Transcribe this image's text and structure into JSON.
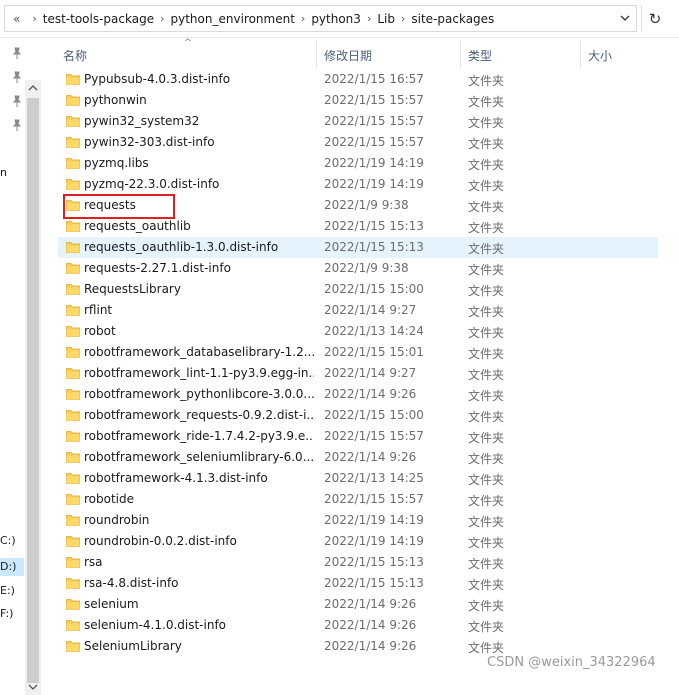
{
  "address": {
    "back_glyph": "«",
    "crumbs": [
      "test-tools-package",
      "python_environment",
      "python3",
      "Lib",
      "site-packages"
    ],
    "separator": "›",
    "refresh_glyph": "↻"
  },
  "columns": {
    "name": "名称",
    "date": "修改日期",
    "type": "类型",
    "size": "大小"
  },
  "nav": {
    "drives": [
      "n",
      "C:)",
      "D:)",
      "E:)",
      "F:)"
    ]
  },
  "files": [
    {
      "name": "Pypubsub-4.0.3.dist-info",
      "date": "2022/1/15 16:57",
      "type": "文件夹"
    },
    {
      "name": "pythonwin",
      "date": "2022/1/15 15:57",
      "type": "文件夹"
    },
    {
      "name": "pywin32_system32",
      "date": "2022/1/15 15:57",
      "type": "文件夹"
    },
    {
      "name": "pywin32-303.dist-info",
      "date": "2022/1/15 15:57",
      "type": "文件夹"
    },
    {
      "name": "pyzmq.libs",
      "date": "2022/1/19 14:19",
      "type": "文件夹"
    },
    {
      "name": "pyzmq-22.3.0.dist-info",
      "date": "2022/1/19 14:19",
      "type": "文件夹"
    },
    {
      "name": "requests",
      "date": "2022/1/9 9:38",
      "type": "文件夹"
    },
    {
      "name": "requests_oauthlib",
      "date": "2022/1/15 15:13",
      "type": "文件夹"
    },
    {
      "name": "requests_oauthlib-1.3.0.dist-info",
      "date": "2022/1/15 15:13",
      "type": "文件夹"
    },
    {
      "name": "requests-2.27.1.dist-info",
      "date": "2022/1/9 9:38",
      "type": "文件夹"
    },
    {
      "name": "RequestsLibrary",
      "date": "2022/1/15 15:00",
      "type": "文件夹"
    },
    {
      "name": "rflint",
      "date": "2022/1/14 9:27",
      "type": "文件夹"
    },
    {
      "name": "robot",
      "date": "2022/1/13 14:24",
      "type": "文件夹"
    },
    {
      "name": "robotframework_databaselibrary-1.2....",
      "date": "2022/1/15 15:01",
      "type": "文件夹"
    },
    {
      "name": "robotframework_lint-1.1-py3.9.egg-in...",
      "date": "2022/1/14 9:27",
      "type": "文件夹"
    },
    {
      "name": "robotframework_pythonlibcore-3.0.0....",
      "date": "2022/1/14 9:26",
      "type": "文件夹"
    },
    {
      "name": "robotframework_requests-0.9.2.dist-i...",
      "date": "2022/1/15 15:00",
      "type": "文件夹"
    },
    {
      "name": "robotframework_ride-1.7.4.2-py3.9.e...",
      "date": "2022/1/15 15:57",
      "type": "文件夹"
    },
    {
      "name": "robotframework_seleniumlibrary-6.0....",
      "date": "2022/1/14 9:26",
      "type": "文件夹"
    },
    {
      "name": "robotframework-4.1.3.dist-info",
      "date": "2022/1/13 14:25",
      "type": "文件夹"
    },
    {
      "name": "robotide",
      "date": "2022/1/15 15:57",
      "type": "文件夹"
    },
    {
      "name": "roundrobin",
      "date": "2022/1/19 14:19",
      "type": "文件夹"
    },
    {
      "name": "roundrobin-0.0.2.dist-info",
      "date": "2022/1/19 14:19",
      "type": "文件夹"
    },
    {
      "name": "rsa",
      "date": "2022/1/15 15:13",
      "type": "文件夹"
    },
    {
      "name": "rsa-4.8.dist-info",
      "date": "2022/1/15 15:13",
      "type": "文件夹"
    },
    {
      "name": "selenium",
      "date": "2022/1/14 9:26",
      "type": "文件夹"
    },
    {
      "name": "selenium-4.1.0.dist-info",
      "date": "2022/1/14 9:26",
      "type": "文件夹"
    },
    {
      "name": "SeleniumLibrary",
      "date": "2022/1/14 9:26",
      "type": "文件夹"
    }
  ],
  "state": {
    "hover_row": 8,
    "annotated_row": 6
  },
  "colors": {
    "folder": "#f7cf5a",
    "hover": "#e5f3ff",
    "annotation": "#e02020"
  },
  "watermark": "CSDN @weixin_34322964"
}
